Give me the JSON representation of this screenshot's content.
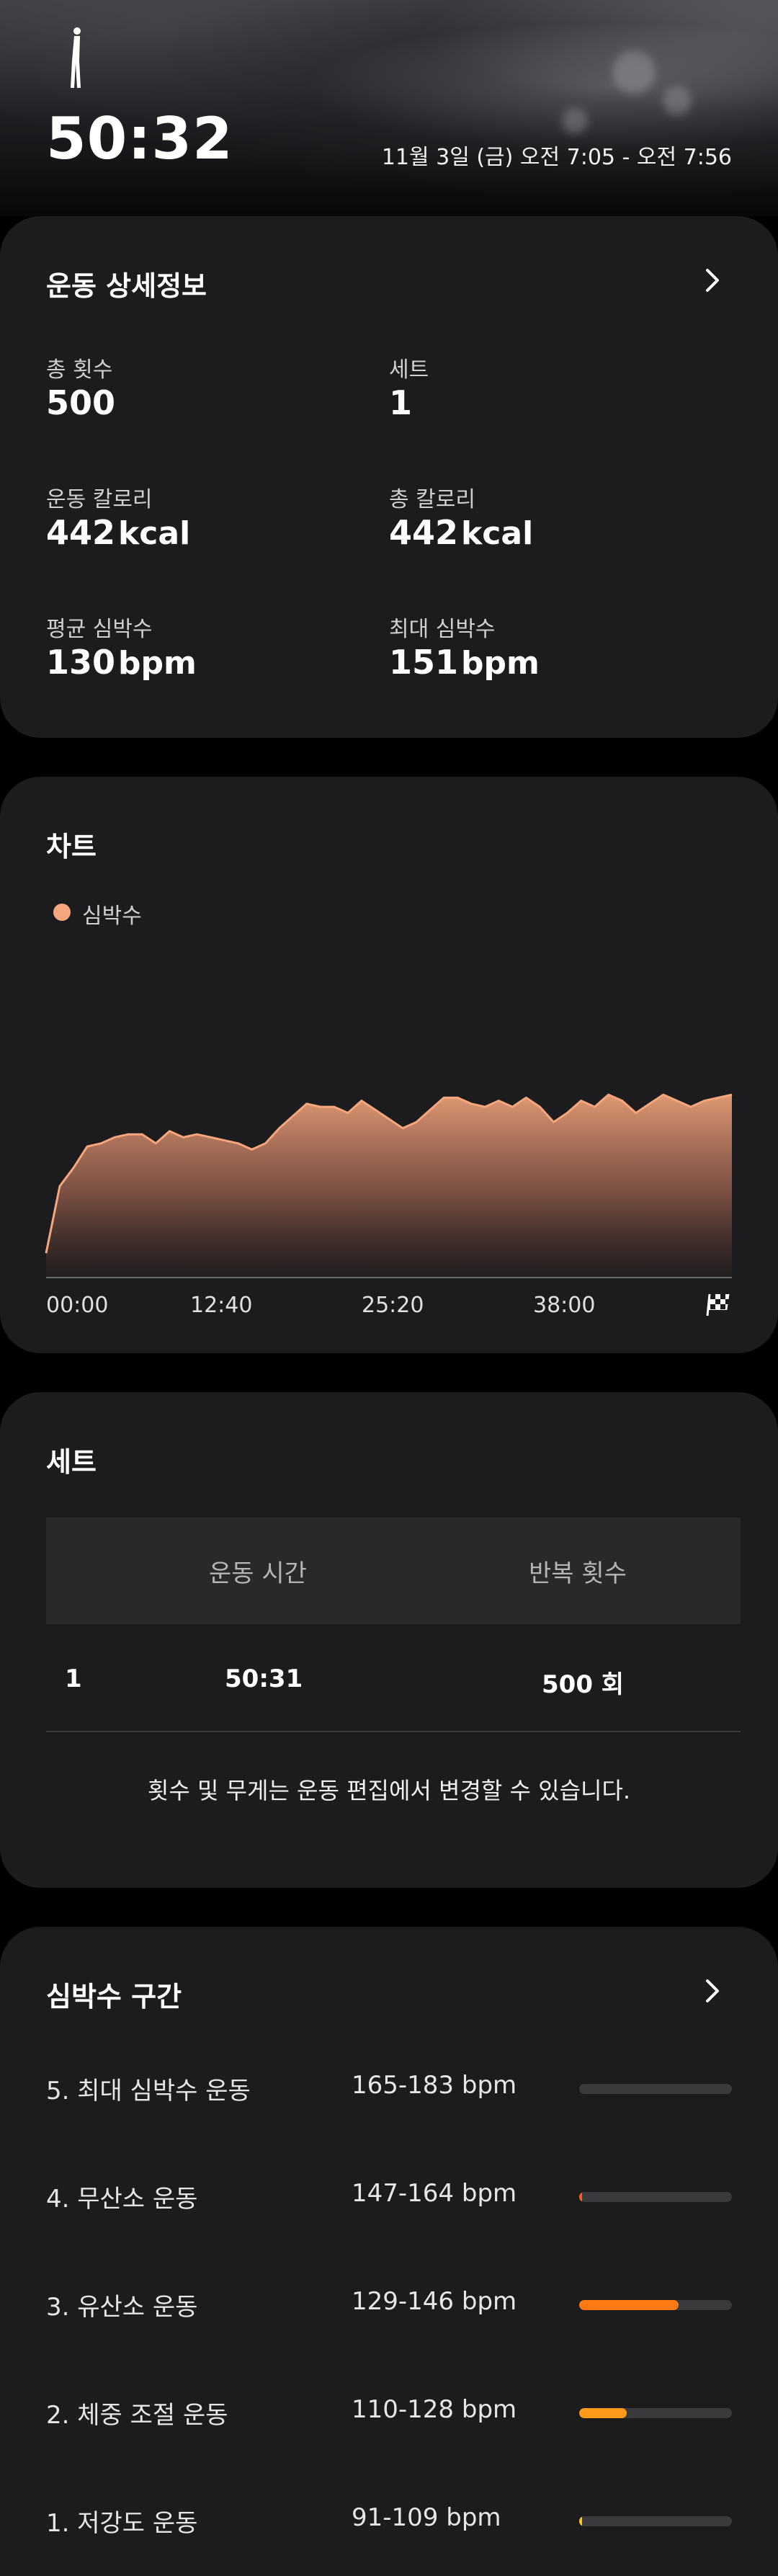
{
  "hero": {
    "duration": "50:32",
    "date_range": "11월 3일 (금) 오전 7:05 - 오전 7:56",
    "icon": "person-standing-icon"
  },
  "details": {
    "title": "운동 상세정보",
    "stats": [
      {
        "label": "총 횟수",
        "value": "500",
        "unit": ""
      },
      {
        "label": "세트",
        "value": "1",
        "unit": ""
      },
      {
        "label": "운동 칼로리",
        "value": "442",
        "unit": "kcal"
      },
      {
        "label": "총 칼로리",
        "value": "442",
        "unit": "kcal"
      },
      {
        "label": "평균 심박수",
        "value": "130",
        "unit": "bpm"
      },
      {
        "label": "최대 심박수",
        "value": "151",
        "unit": "bpm"
      }
    ]
  },
  "chart": {
    "title": "차트",
    "legend": "심박수",
    "x_ticks": [
      "00:00",
      "12:40",
      "25:20",
      "38:00"
    ],
    "finish_icon": "checkered-flag-icon",
    "color": "#f5a67c"
  },
  "chart_data": {
    "type": "area",
    "series": [
      {
        "name": "심박수",
        "x_minutes": [
          0,
          1,
          2,
          3,
          4,
          5,
          6,
          7,
          8,
          9,
          10,
          11,
          12,
          13,
          14,
          15,
          16,
          17,
          18,
          19,
          20,
          21,
          22,
          23,
          24,
          25,
          26,
          27,
          28,
          29,
          30,
          31,
          32,
          33,
          34,
          35,
          36,
          37,
          38,
          39,
          40,
          41,
          42,
          43,
          44,
          45,
          46,
          47,
          48,
          49,
          50
        ],
        "values": [
          78,
          100,
          106,
          113,
          114,
          116,
          117,
          117,
          114,
          118,
          116,
          117,
          116,
          115,
          114,
          112,
          114,
          119,
          123,
          127,
          126,
          126,
          124,
          128,
          125,
          122,
          119,
          121,
          125,
          129,
          129,
          127,
          126,
          128,
          126,
          129,
          126,
          121,
          124,
          128,
          126,
          130,
          128,
          124,
          127,
          130,
          128,
          126,
          128,
          129,
          130
        ]
      }
    ]
  },
  "sets": {
    "title": "세트",
    "headers": [
      "운동 시간",
      "반복 횟수"
    ],
    "rows": [
      {
        "index": "1",
        "time": "50:31",
        "reps": "500 회"
      }
    ],
    "note": "횟수 및 무게는 운동 편집에서 변경할 수 있습니다."
  },
  "zones": {
    "title": "심박수 구간",
    "items": [
      {
        "name": "5. 최대 심박수 운동",
        "range": "165-183 bpm",
        "fraction": 0.0,
        "color": "#ff5a1f"
      },
      {
        "name": "4. 무산소 운동",
        "range": "147-164 bpm",
        "fraction": 0.02,
        "color": "#ff5a1f"
      },
      {
        "name": "3. 유산소 운동",
        "range": "129-146 bpm",
        "fraction": 0.65,
        "color": "#ff7a12"
      },
      {
        "name": "2. 체중 조절 운동",
        "range": "110-128 bpm",
        "fraction": 0.31,
        "color": "#ff9a1a"
      },
      {
        "name": "1. 저강도 운동",
        "range": "91-109 bpm",
        "fraction": 0.02,
        "color": "#ffc61a"
      }
    ]
  }
}
